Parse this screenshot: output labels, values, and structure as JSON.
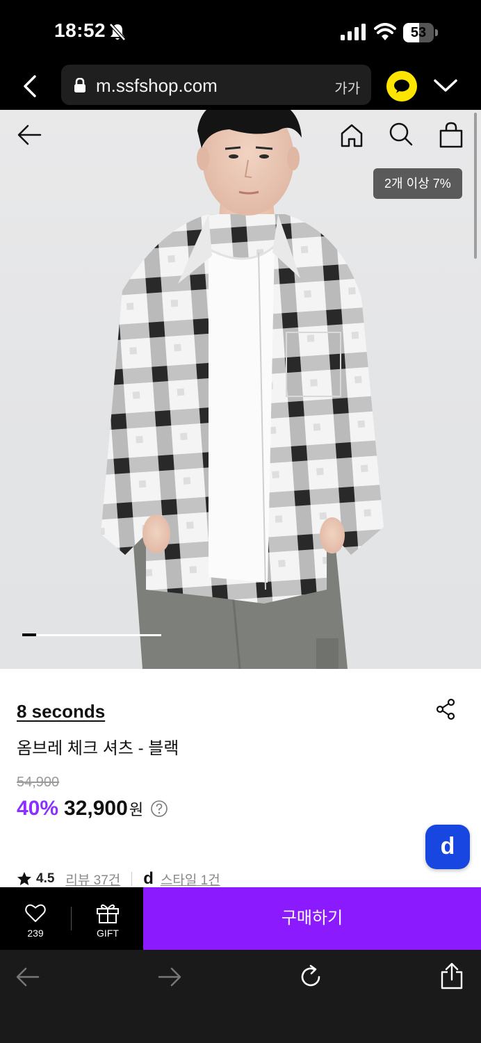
{
  "status_bar": {
    "time": "18:52",
    "battery_level": "53",
    "battery_percent": 0.53,
    "icons": [
      "bell-slash-icon",
      "cellular-signal-icon",
      "wifi-icon",
      "battery-icon"
    ]
  },
  "browser": {
    "url": "m.ssfshop.com",
    "text_size_label": "가가",
    "icons": [
      "back-chevron-icon",
      "lock-icon",
      "kakao-talk-icon",
      "chevron-down-icon"
    ]
  },
  "hero": {
    "promo_badge": "2개 이상 7%",
    "slide_progress": 0.1,
    "icons": [
      "back-arrow-icon",
      "home-icon",
      "search-icon",
      "shopping-bag-icon"
    ]
  },
  "product": {
    "brand": "8 seconds",
    "name": "옴브레 체크 셔츠 - 블랙",
    "original_price": "54,900",
    "discount": "40%",
    "sale_price": "32,900",
    "currency": "원",
    "rating": "4.5",
    "review_link": "리뷰 37건",
    "style_logo": "d",
    "style_link": "스타일 1건"
  },
  "floating_button": {
    "label": "d"
  },
  "buy_bar": {
    "like_count": "239",
    "gift_label": "GIFT",
    "purchase_label": "구매하기"
  },
  "colors": {
    "accent_purple": "#8b1aff",
    "discount_purple": "#8b31ff",
    "kakao_yellow": "#fee500",
    "fab_blue": "#1747e0"
  }
}
